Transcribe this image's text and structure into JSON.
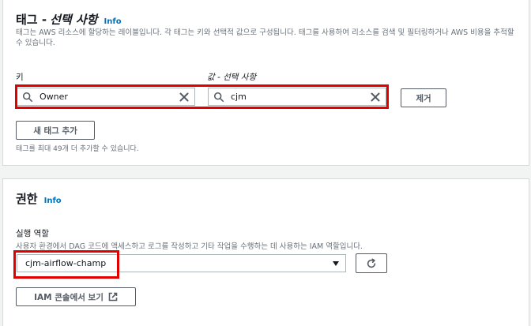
{
  "tags": {
    "title": "태그 -",
    "title_optional": "선택 사항",
    "info": "Info",
    "description": "태그는 AWS 리소스에 할당하는 레이블입니다. 각 태그는 키와 선택적 값으로 구성됩니다. 태그를 사용하여 리소스를 검색 및 필터링하거나 AWS 비용을 추적할 수 있습니다.",
    "key_label": "키",
    "value_label": "값 - 선택 사항",
    "key_value": "Owner",
    "value_value": "cjm",
    "remove_button": "제거",
    "add_button": "새 태그 추가",
    "hint": "태그를 최대 49개 더 추가할 수 있습니다."
  },
  "permissions": {
    "title": "권한",
    "info": "Info",
    "role_label": "실행 역할",
    "role_description": "사용자 환경에서 DAG 코드에 액세스하고 로그를 작성하고 기타 작업을 수행하는 데 사용하는 IAM 역할입니다.",
    "role_value": "cjm-airflow-champ",
    "iam_button": "IAM 콘솔에서 보기"
  },
  "icons": [
    "search-icon",
    "clear-icon",
    "refresh-icon",
    "external-link-icon",
    "chevron-down-icon"
  ],
  "colors": {
    "highlight": "#e00000",
    "link": "#0073bb"
  }
}
